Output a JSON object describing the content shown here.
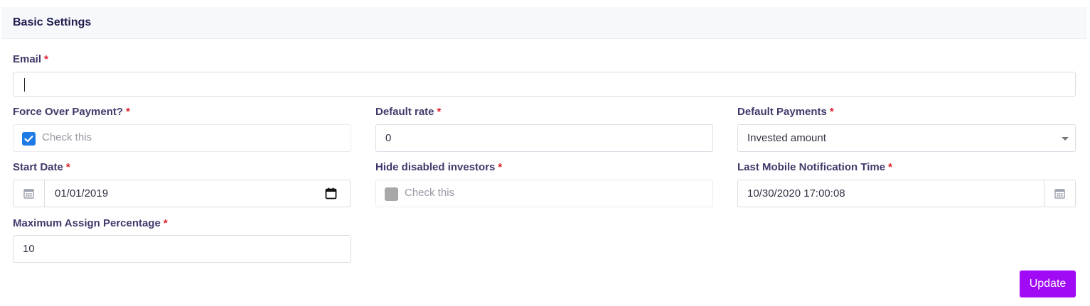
{
  "header": {
    "title": "Basic Settings"
  },
  "required_mark": "*",
  "fields": {
    "email": {
      "label": "Email",
      "value": ""
    },
    "force_over_payment": {
      "label": "Force Over Payment?",
      "checkbox_text": "Check this",
      "checked": true
    },
    "default_rate": {
      "label": "Default rate",
      "value": "0"
    },
    "default_payments": {
      "label": "Default Payments",
      "selected": "Invested amount"
    },
    "start_date": {
      "label": "Start Date",
      "value": "01/01/2019"
    },
    "hide_disabled_investors": {
      "label": "Hide disabled investors",
      "checkbox_text": "Check this",
      "checked": false,
      "disabled": true
    },
    "last_mobile_notification_time": {
      "label": "Last Mobile Notification Time",
      "value": "10/30/2020 17:00:08"
    },
    "maximum_assign_percentage": {
      "label": "Maximum Assign Percentage",
      "value": "10"
    }
  },
  "actions": {
    "update_label": "Update"
  },
  "colors": {
    "accent": "#a10af5",
    "checkbox_checked": "#1e7be6",
    "required": "#e11d2a",
    "label": "#3f3a6b"
  },
  "icons": {
    "calendar": "calendar-icon",
    "check": "check-icon",
    "dropdown": "chevron-down-icon"
  }
}
